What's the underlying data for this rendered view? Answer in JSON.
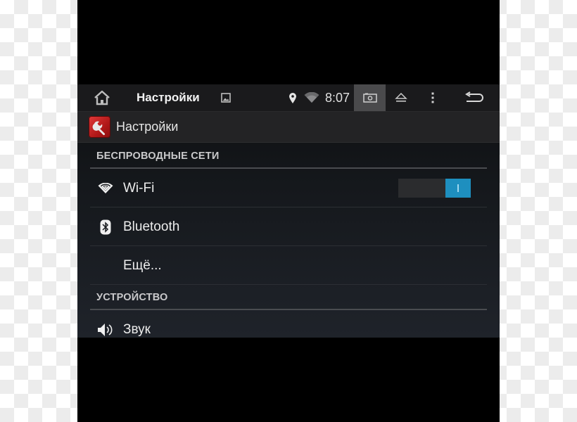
{
  "statusbar": {
    "title": "Настройки",
    "time": "8:07",
    "icons": [
      "home-icon",
      "gallery-icon",
      "location-icon",
      "wifi-signal-icon",
      "screenshot-icon",
      "eject-icon",
      "overflow-menu-icon",
      "back-icon"
    ]
  },
  "actionbar": {
    "title": "Настройки",
    "icon": "settings-wrench-icon"
  },
  "sections": [
    {
      "header": "БЕСПРОВОДНЫЕ СЕТИ",
      "items": [
        {
          "label": "Wi-Fi",
          "icon": "wifi-icon",
          "toggle": true,
          "toggle_on": true,
          "toggle_text": "I"
        },
        {
          "label": "Bluetooth",
          "icon": "bluetooth-icon"
        },
        {
          "label": "Ещё...",
          "icon": ""
        }
      ]
    },
    {
      "header": "УСТРОЙСТВО",
      "items": [
        {
          "label": "Звук",
          "icon": "volume-icon"
        }
      ]
    }
  ],
  "colors": {
    "accent": "#1e8fbf",
    "app_icon": "#c41f1f",
    "highlight_tile": "#4a4a4c"
  }
}
